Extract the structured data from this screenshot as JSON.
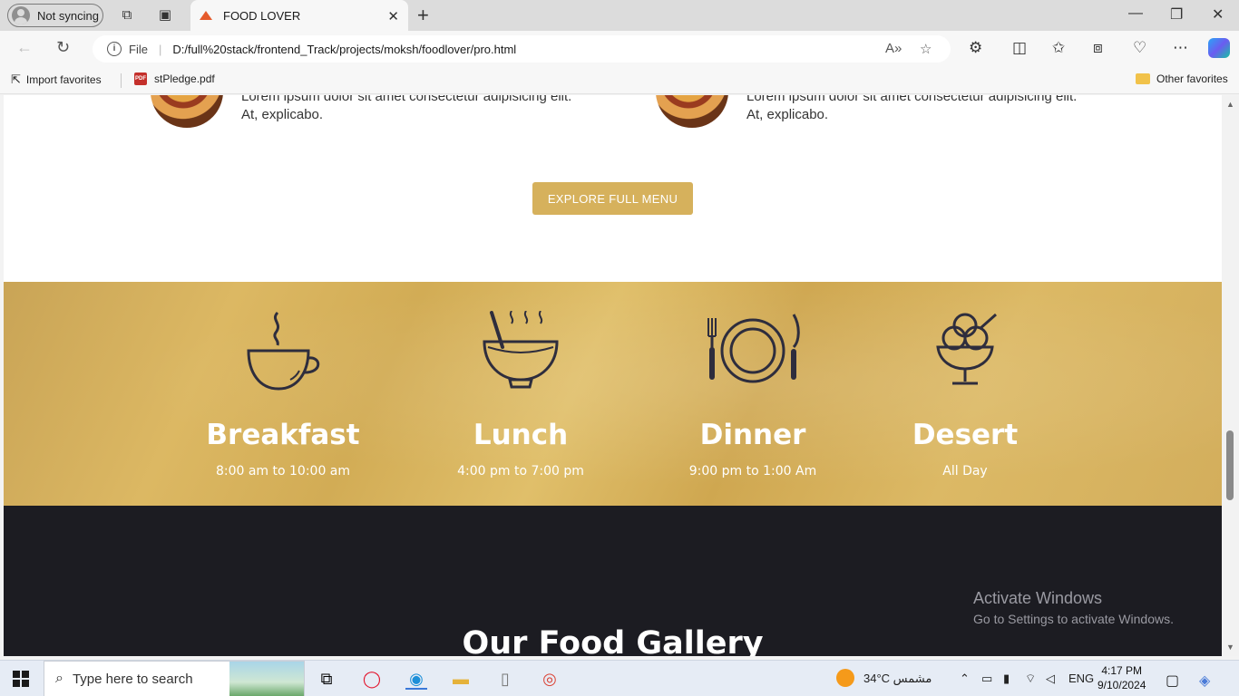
{
  "browser": {
    "profile_label": "Not syncing",
    "tab_title": "FOOD LOVER",
    "file_label": "File",
    "address": "D:/full%20stack/frontend_Track/projects/moksh/foodlover/pro.html"
  },
  "favorites": {
    "import_label": "Import favorites",
    "pdf_label": "stPledge.pdf",
    "other_label": "Other favorites"
  },
  "page": {
    "items": [
      {
        "text": "Lorem ipsum dolor sit amet consectetur adipisicing elit. At, explicabo."
      },
      {
        "text": "Lorem ipsum dolor sit amet consectetur adipisicing elit. At, explicabo."
      }
    ],
    "explore_button": "EXPLORE FULL MENU",
    "meals": [
      {
        "name": "Breakfast",
        "time": "8:00 am to 10:00 am",
        "icon": "coffee-cup-icon"
      },
      {
        "name": "Lunch",
        "time": "4:00 pm to 7:00 pm",
        "icon": "soup-bowl-icon"
      },
      {
        "name": "Dinner",
        "time": "9:00 pm to 1:00 Am",
        "icon": "plate-cutlery-icon"
      },
      {
        "name": "Desert",
        "time": "All Day",
        "icon": "ice-cream-icon"
      }
    ],
    "gallery_title": "Our Food Gallery",
    "activate_title": "Activate Windows",
    "activate_sub": "Go to Settings to activate Windows."
  },
  "taskbar": {
    "search_placeholder": "Type here to search",
    "weather": "34°C  مشمس",
    "language": "ENG",
    "time": "4:17 PM",
    "date": "9/10/2024"
  },
  "colors": {
    "accent_gold": "#d6b15c",
    "dark_section": "#1c1c22",
    "icon_stroke": "#2e2d3d"
  }
}
